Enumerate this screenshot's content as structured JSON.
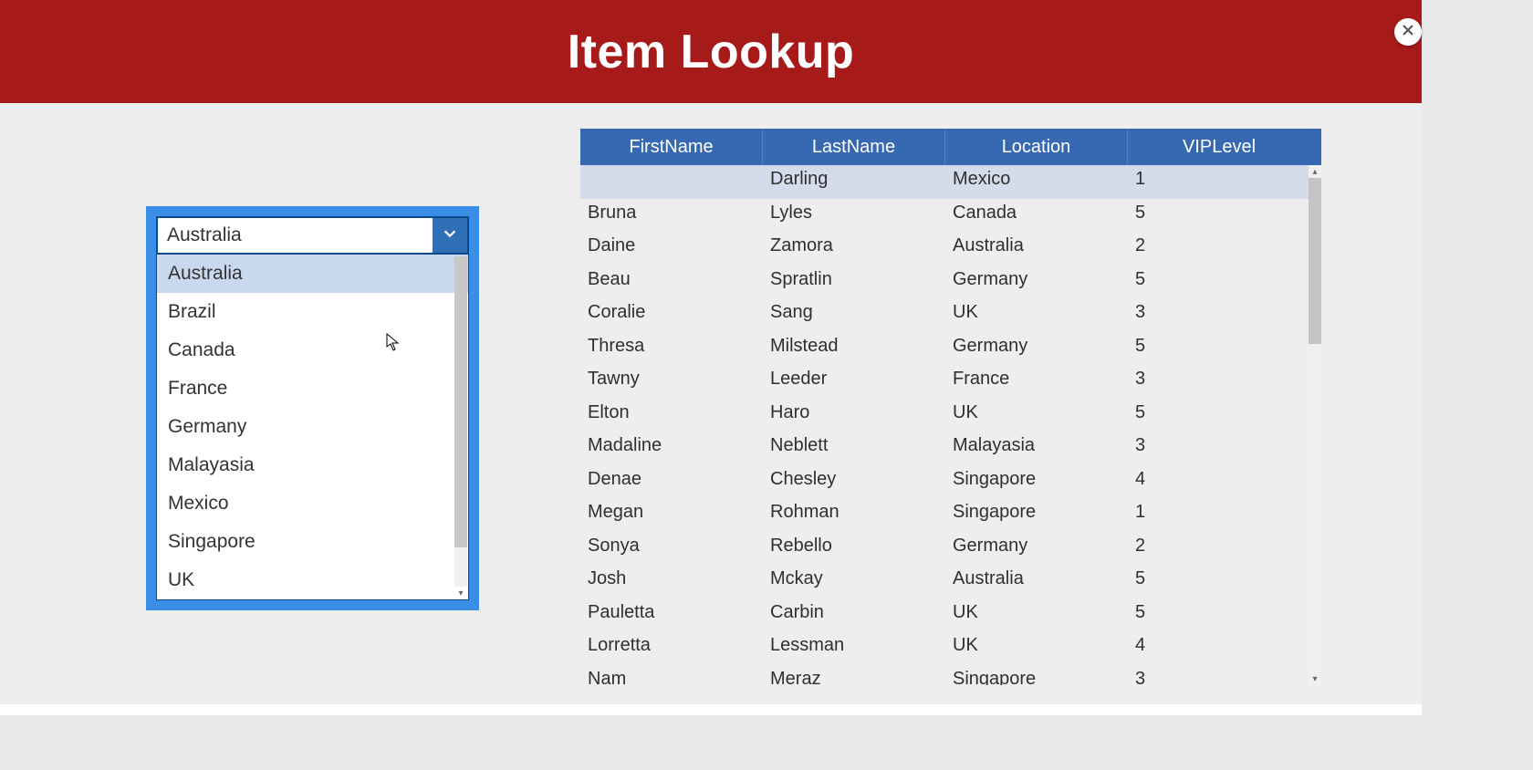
{
  "header": {
    "title": "Item Lookup"
  },
  "dropdown": {
    "selected": "Australia",
    "highlighted_index": 0,
    "options": [
      "Australia",
      "Brazil",
      "Canada",
      "France",
      "Germany",
      "Malayasia",
      "Mexico",
      "Singapore",
      "UK"
    ]
  },
  "table": {
    "columns": [
      "FirstName",
      "LastName",
      "Location",
      "VIPLevel"
    ],
    "selected_row_index": 0,
    "rows": [
      {
        "FirstName": "",
        "LastName": "Darling",
        "Location": "Mexico",
        "VIPLevel": "1"
      },
      {
        "FirstName": "Bruna",
        "LastName": "Lyles",
        "Location": "Canada",
        "VIPLevel": "5"
      },
      {
        "FirstName": "Daine",
        "LastName": "Zamora",
        "Location": "Australia",
        "VIPLevel": "2"
      },
      {
        "FirstName": "Beau",
        "LastName": "Spratlin",
        "Location": "Germany",
        "VIPLevel": "5"
      },
      {
        "FirstName": "Coralie",
        "LastName": "Sang",
        "Location": "UK",
        "VIPLevel": "3"
      },
      {
        "FirstName": "Thresa",
        "LastName": "Milstead",
        "Location": "Germany",
        "VIPLevel": "5"
      },
      {
        "FirstName": "Tawny",
        "LastName": "Leeder",
        "Location": "France",
        "VIPLevel": "3"
      },
      {
        "FirstName": "Elton",
        "LastName": "Haro",
        "Location": "UK",
        "VIPLevel": "5"
      },
      {
        "FirstName": "Madaline",
        "LastName": "Neblett",
        "Location": "Malayasia",
        "VIPLevel": "3"
      },
      {
        "FirstName": "Denae",
        "LastName": "Chesley",
        "Location": "Singapore",
        "VIPLevel": "4"
      },
      {
        "FirstName": "Megan",
        "LastName": "Rohman",
        "Location": "Singapore",
        "VIPLevel": "1"
      },
      {
        "FirstName": "Sonya",
        "LastName": "Rebello",
        "Location": "Germany",
        "VIPLevel": "2"
      },
      {
        "FirstName": "Josh",
        "LastName": "Mckay",
        "Location": "Australia",
        "VIPLevel": "5"
      },
      {
        "FirstName": "Pauletta",
        "LastName": "Carbin",
        "Location": "UK",
        "VIPLevel": "5"
      },
      {
        "FirstName": "Lorretta",
        "LastName": "Lessman",
        "Location": "UK",
        "VIPLevel": "4"
      },
      {
        "FirstName": "Nam",
        "LastName": "Meraz",
        "Location": "Singapore",
        "VIPLevel": "3"
      }
    ]
  }
}
